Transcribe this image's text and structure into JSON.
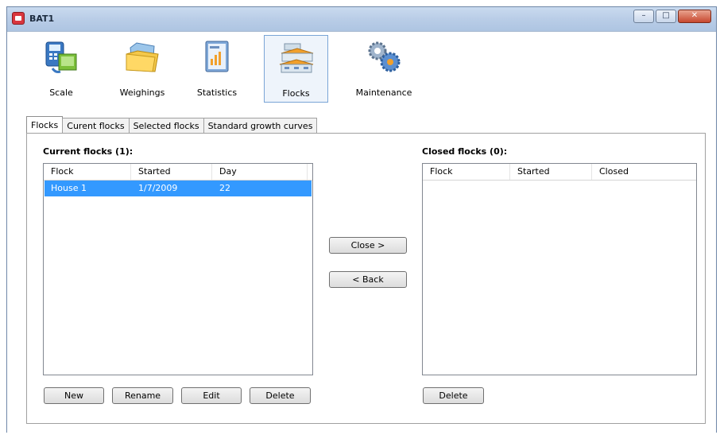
{
  "window": {
    "title": "BAT1"
  },
  "window_controls": {
    "minimize": "–",
    "maximize": "□",
    "close": "✕"
  },
  "toolbar": {
    "items": [
      {
        "label": "Scale",
        "icon": "scale-icon"
      },
      {
        "label": "Weighings",
        "icon": "folder-icon"
      },
      {
        "label": "Statistics",
        "icon": "statistics-icon"
      },
      {
        "label": "Flocks",
        "icon": "flocks-icon",
        "active": true
      },
      {
        "label": "Maintenance",
        "icon": "gears-icon"
      }
    ]
  },
  "tabs": [
    {
      "label": "Flocks",
      "active": true
    },
    {
      "label": "Curent flocks"
    },
    {
      "label": "Selected flocks"
    },
    {
      "label": "Standard growth curves"
    }
  ],
  "current": {
    "header": "Current flocks (1):",
    "columns": [
      "Flock",
      "Started",
      "Day"
    ],
    "rows": [
      {
        "flock": "House 1",
        "started": "1/7/2009",
        "day": "22",
        "selected": true
      }
    ]
  },
  "closed": {
    "header": "Closed flocks (0):",
    "columns": [
      "Flock",
      "Started",
      "Closed"
    ],
    "rows": []
  },
  "buttons": {
    "close": "Close  >",
    "back": "<  Back",
    "new": "New",
    "rename": "Rename",
    "edit": "Edit",
    "delete": "Delete",
    "delete_closed": "Delete"
  },
  "colors": {
    "selection": "#3399ff",
    "active_tool_border": "#7aa5d6"
  }
}
